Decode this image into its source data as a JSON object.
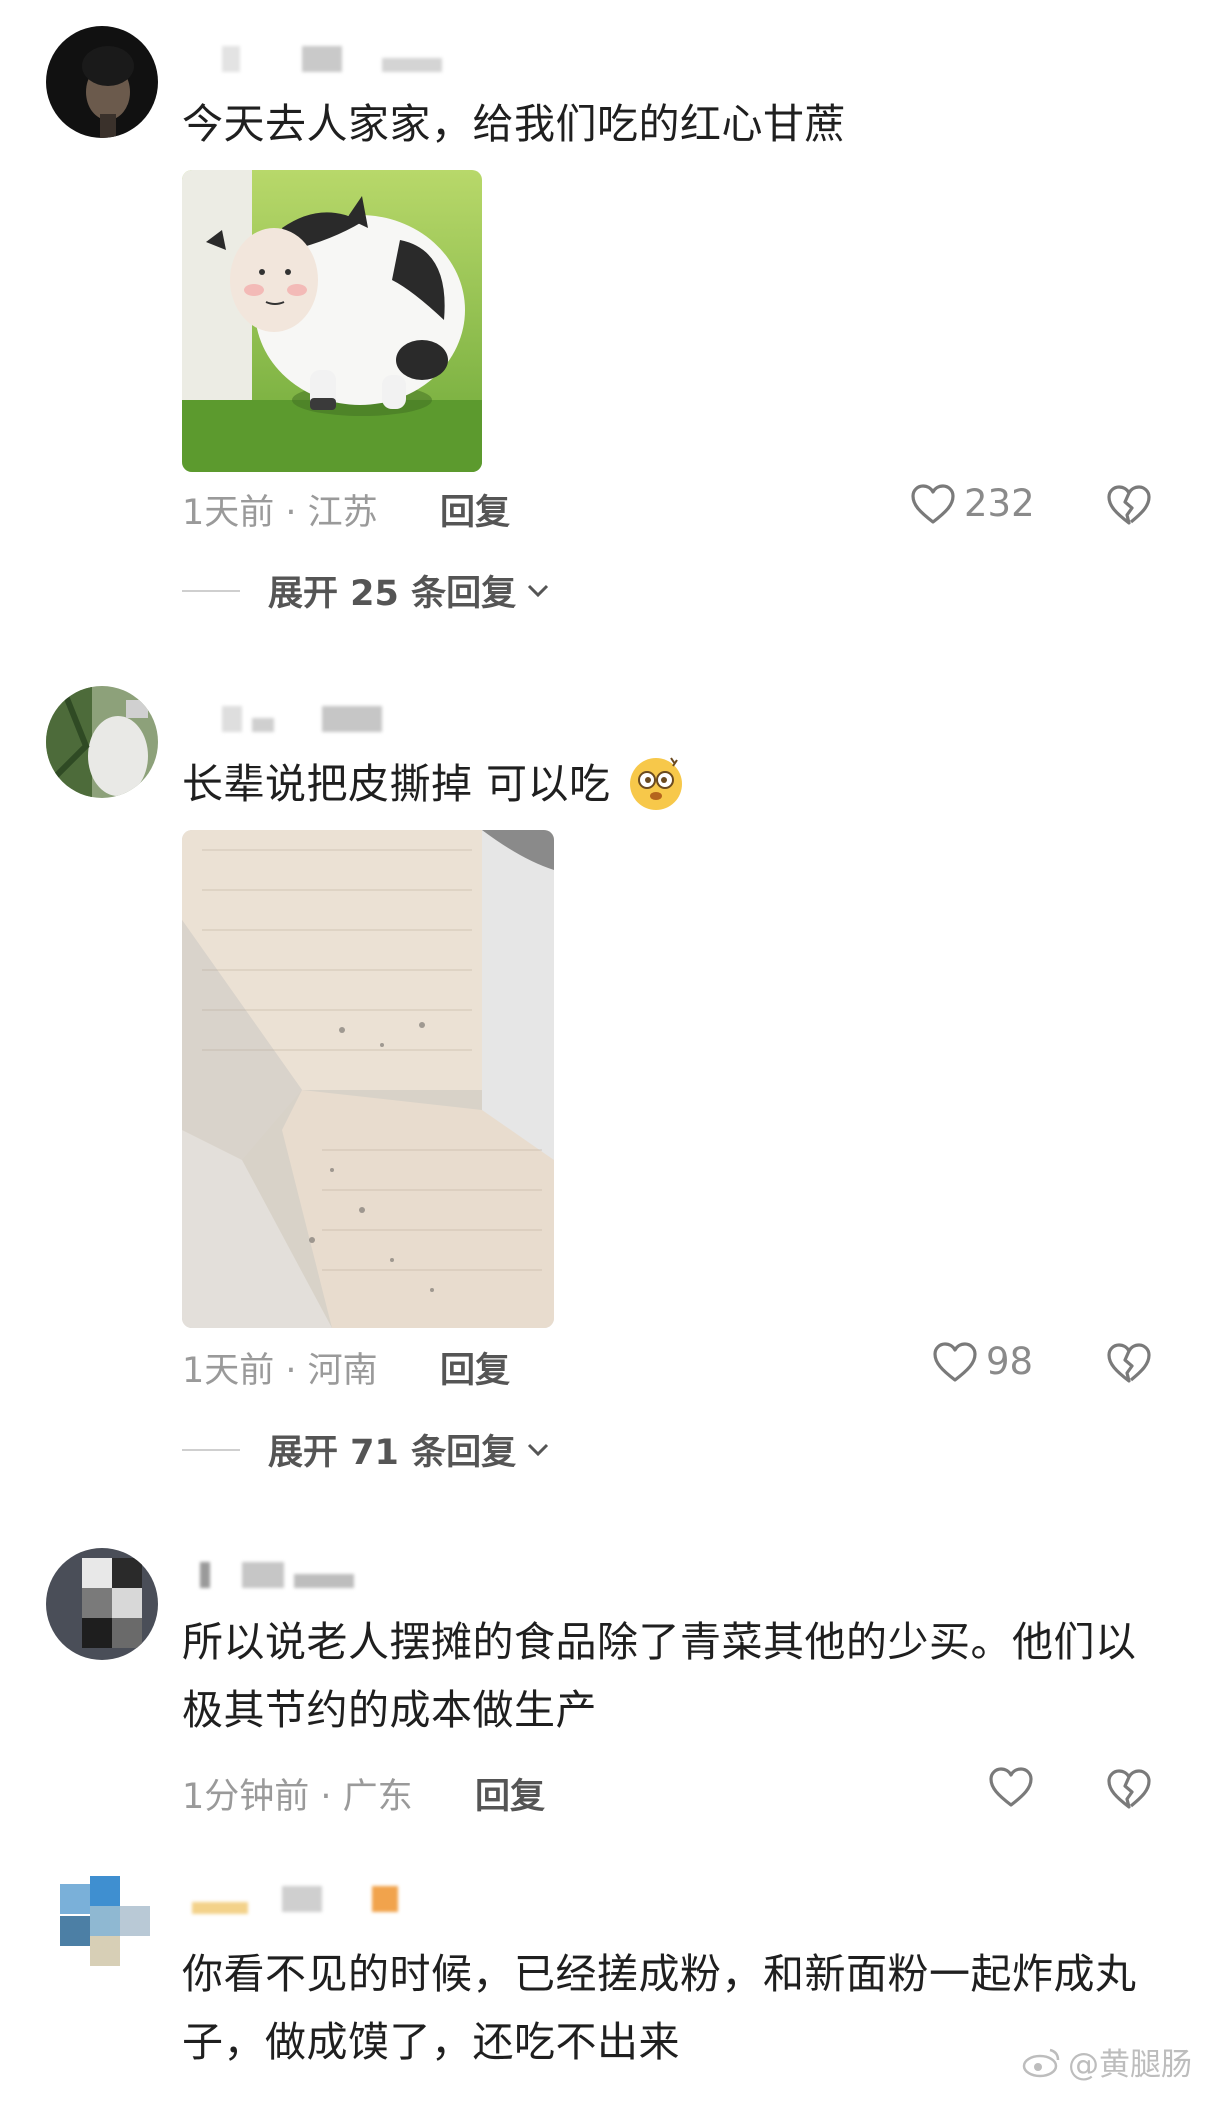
{
  "comments": [
    {
      "text": "今天去人家家，给我们吃的红心甘蔗",
      "time_location": "1天前 · 江苏",
      "reply_label": "回复",
      "likes": "232",
      "expand_label": "展开 25 条回复"
    },
    {
      "text": "长辈说把皮撕掉 可以吃",
      "time_location": "1天前 · 河南",
      "reply_label": "回复",
      "likes": "98",
      "expand_label": "展开 71 条回复"
    },
    {
      "text": "所以说老人摆摊的食品除了青菜其他的少买。他们以极其节约的成本做生产",
      "time_location": "1分钟前 · 广东",
      "reply_label": "回复",
      "likes": ""
    },
    {
      "text": "你看不见的时候，已经搓成粉，和新面粉一起炸成丸子，做成馍了，还吃不出来"
    }
  ],
  "watermark": "@黄腿肠",
  "icons": {
    "like": "heart-outline-icon",
    "dislike": "broken-heart-icon",
    "expand": "chevron-down-icon",
    "watermark": "weibo-logo-icon",
    "emoji": "dizzy-face-emoji"
  },
  "colors": {
    "text": "#1f1f1f",
    "meta": "#9a9a9a",
    "reply": "#555555"
  }
}
